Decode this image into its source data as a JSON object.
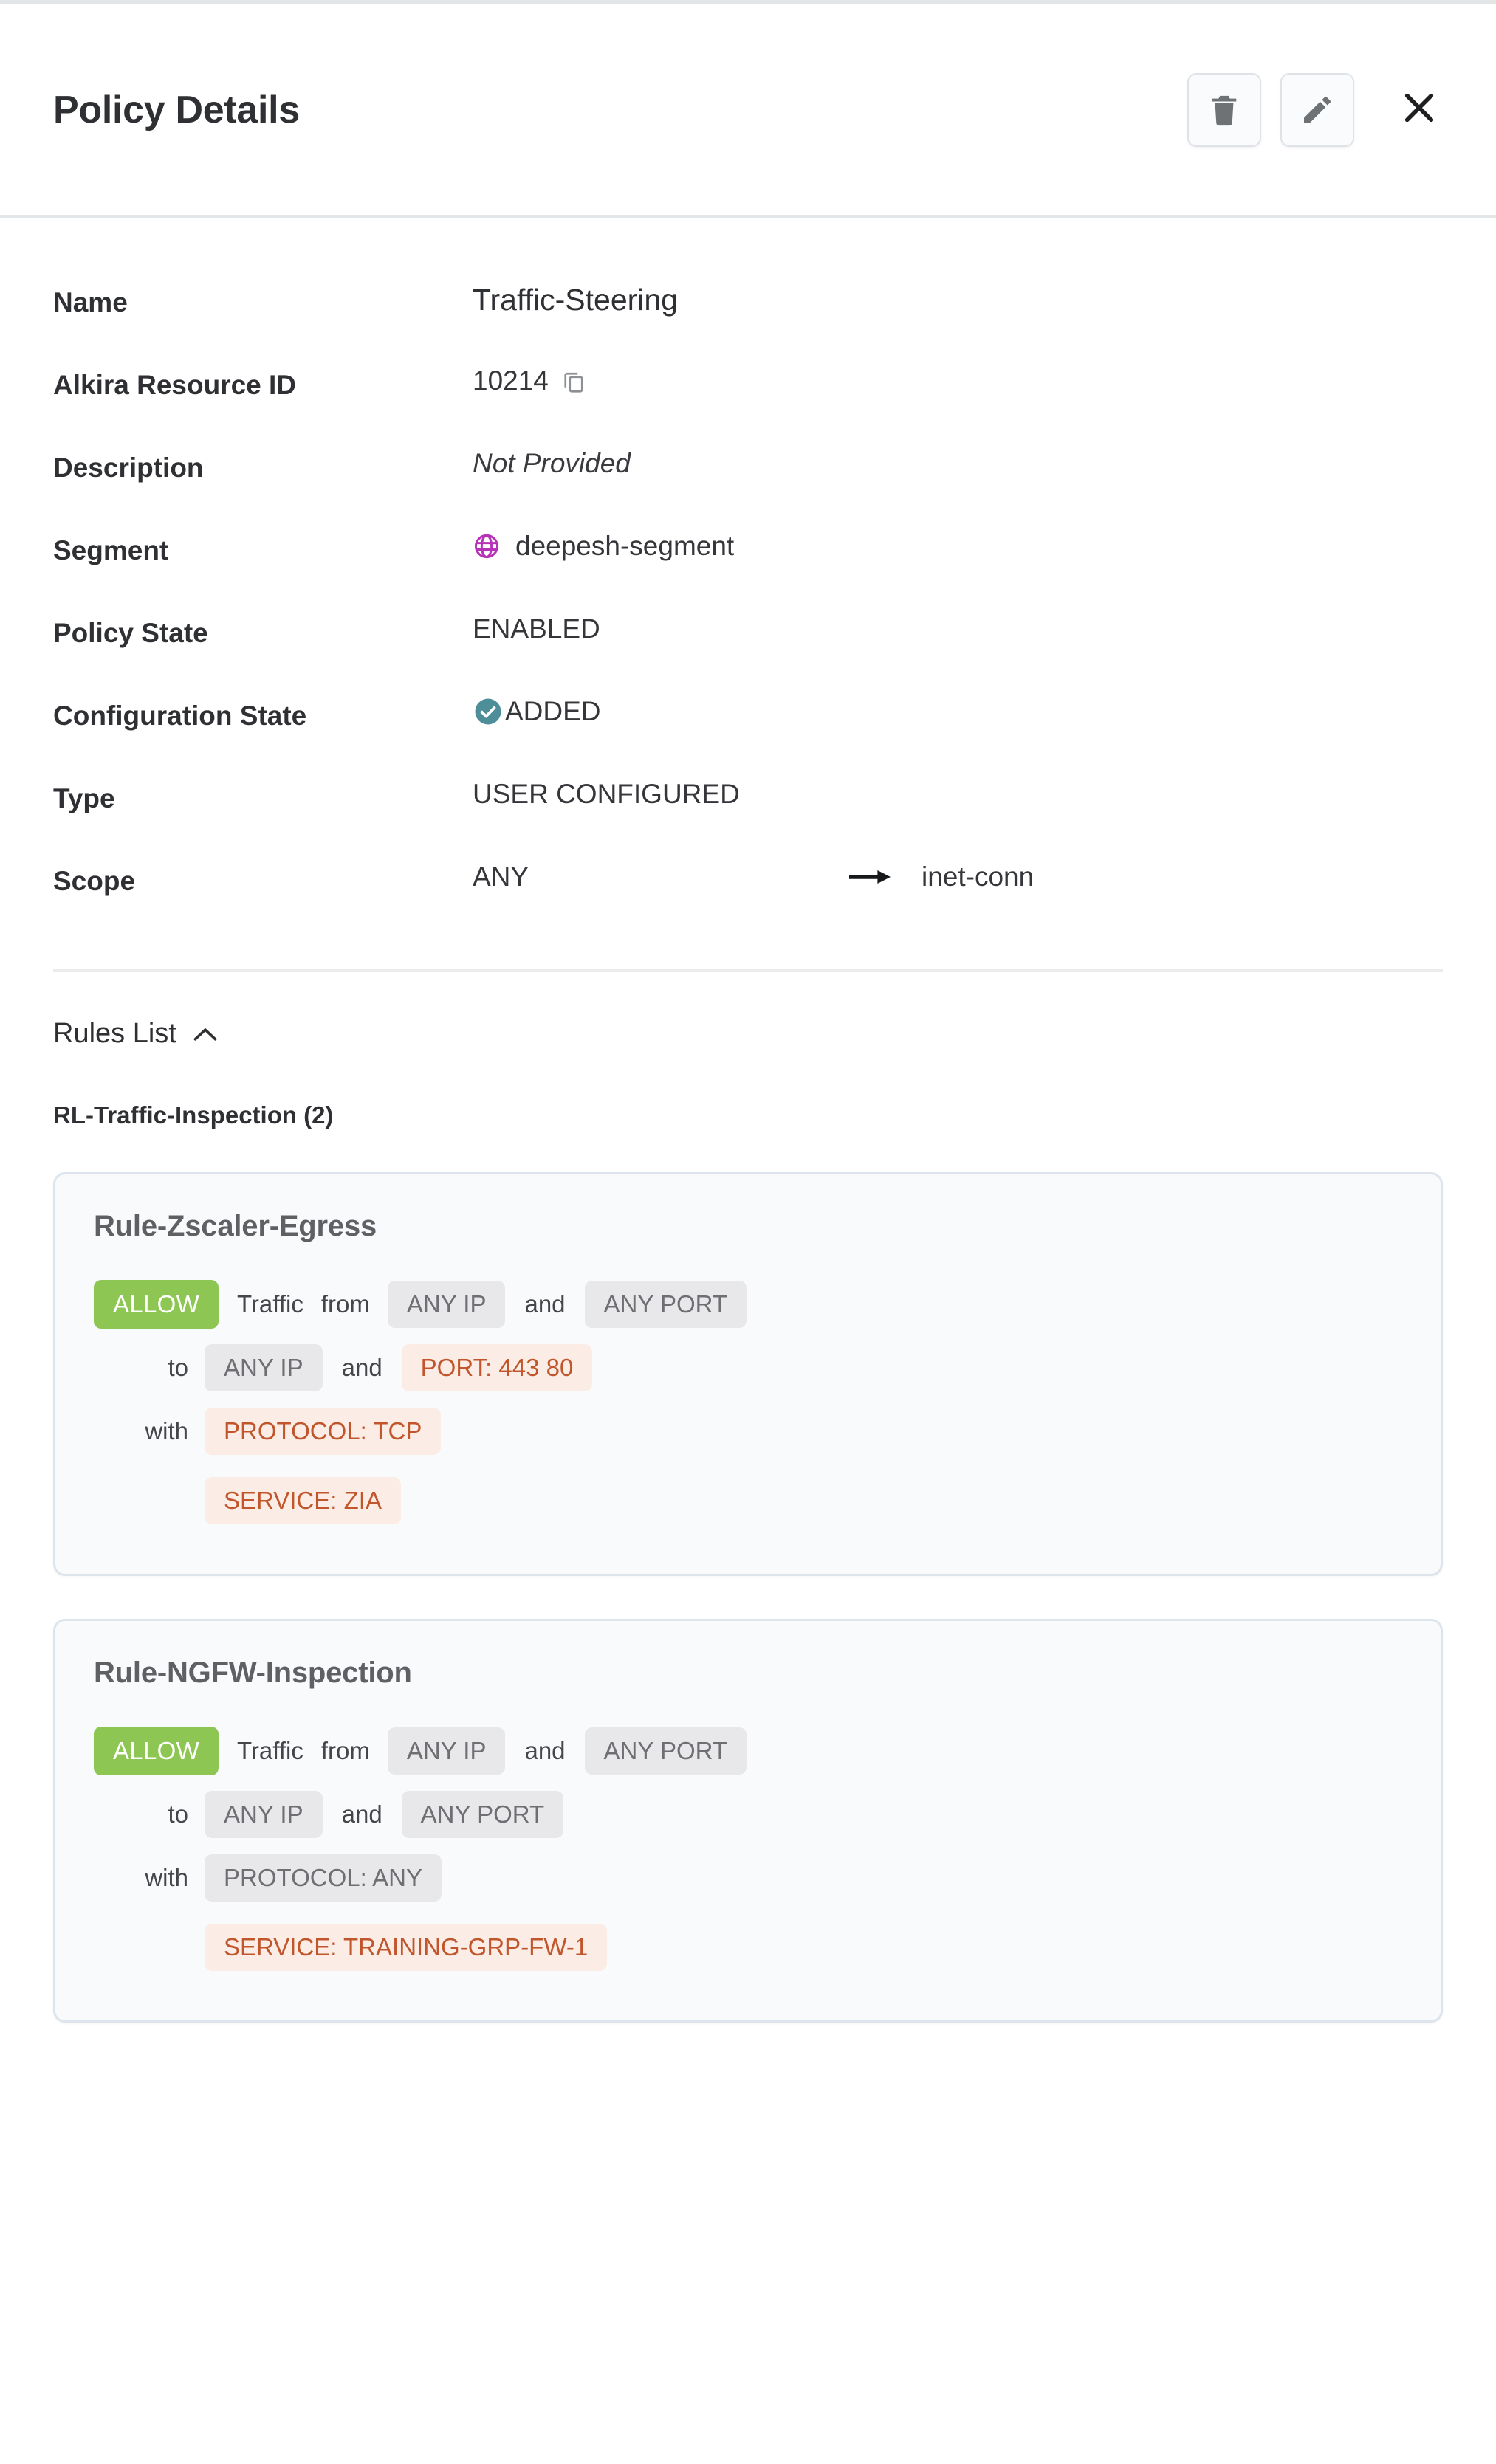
{
  "header": {
    "title": "Policy Details",
    "delete_icon": "trash-icon",
    "edit_icon": "pencil-icon",
    "close_icon": "close-icon"
  },
  "details": [
    {
      "label": "Name",
      "value": "Traffic-Steering"
    },
    {
      "label": "Alkira Resource ID",
      "value": "10214",
      "copy_icon": "copy-icon"
    },
    {
      "label": "Description",
      "value": "Not Provided"
    },
    {
      "label": "Segment",
      "value": "deepesh-segment",
      "icon": "globe-icon"
    },
    {
      "label": "Policy State",
      "value": "ENABLED"
    },
    {
      "label": "Configuration State",
      "value": "ADDED",
      "icon": "check-circle-icon"
    },
    {
      "label": "Type",
      "value": "USER CONFIGURED"
    },
    {
      "label": "Scope",
      "value": "ANY",
      "arrow_icon": "arrow-right-icon",
      "target": "inet-conn"
    }
  ],
  "rules": {
    "section_label": "Rules List",
    "collapse_icon": "chevron-up-icon",
    "group_label": "RL-Traffic-Inspection (2)",
    "cards": [
      {
        "name": "Rule-Zscaler-Egress",
        "action": "ALLOW",
        "traffic_kw": "Traffic",
        "from_kw": "from",
        "from_ip": "ANY IP",
        "and_kw_1": "and",
        "from_port": "ANY PORT",
        "to_kw": "to",
        "to_ip": "ANY IP",
        "and_kw_2": "and",
        "to_port": "PORT: 443 80",
        "to_port_highlight": true,
        "with_kw": "with",
        "protocol": "PROTOCOL: TCP",
        "protocol_highlight": true,
        "service": "SERVICE: ZIA",
        "service_highlight": true
      },
      {
        "name": "Rule-NGFW-Inspection",
        "action": "ALLOW",
        "traffic_kw": "Traffic",
        "from_kw": "from",
        "from_ip": "ANY IP",
        "and_kw_1": "and",
        "from_port": "ANY PORT",
        "to_kw": "to",
        "to_ip": "ANY IP",
        "and_kw_2": "and",
        "to_port": "ANY PORT",
        "to_port_highlight": false,
        "with_kw": "with",
        "protocol": "PROTOCOL: ANY",
        "protocol_highlight": false,
        "service": "SERVICE: TRAINING-GRP-FW-1",
        "service_highlight": true
      }
    ]
  },
  "colors": {
    "allow_green": "#8dc653",
    "chip_orange_text": "#c1562c",
    "chip_orange_bg": "#fbede5",
    "chip_gray_bg": "#e8e8ea",
    "chip_gray_text": "#6e6e73",
    "segment_globe": "#b832b8",
    "check_teal": "#4d8e99"
  }
}
